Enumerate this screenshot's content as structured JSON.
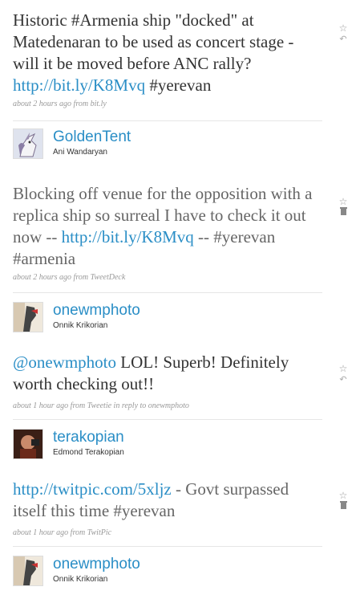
{
  "tweets": [
    {
      "segments": [
        "Historic #Armenia ship \"docked\" at Matedenaran to be used as concert stage - will it be moved before ANC rally? ",
        "http://bit.ly/K8Mvq",
        " #yerevan"
      ],
      "meta": "about 2 hours ago from bit.ly",
      "icons": [
        "star-icon",
        "reply-icon"
      ]
    },
    {
      "segments": [
        "Blocking off venue for the opposition with a replica ship so surreal I have to check it out now -- ",
        "http://bit.ly/K8Mvq",
        " -- #yerevan #armenia"
      ],
      "meta": "about 2 hours ago from TweetDeck",
      "icons": [
        "star-icon",
        "trash-icon"
      ]
    },
    {
      "segments": [
        "@",
        "onewmphoto",
        " LOL! Superb! Definitely worth checking out!!"
      ],
      "meta": "about 1 hour ago from Tweetie in reply to onewmphoto",
      "icons": [
        "star-icon",
        "reply-icon"
      ]
    },
    {
      "segments": [
        "http://twitpic.com/5xljz",
        " - Govt surpassed itself this time #yerevan"
      ],
      "meta": "about 1 hour ago from TwitPic",
      "icons": [
        "star-icon",
        "trash-icon"
      ]
    }
  ],
  "users": [
    {
      "screen_name": "GoldenTent",
      "full_name": "Ani Wandaryan",
      "avatar": "unicorn-avatar"
    },
    {
      "screen_name": "onewmphoto",
      "full_name": "Onnik Krikorian",
      "avatar": "sketch-avatar"
    },
    {
      "screen_name": "terakopian",
      "full_name": "Edmond Terakopian",
      "avatar": "photo-avatar"
    },
    {
      "screen_name": "onewmphoto",
      "full_name": "Onnik Krikorian",
      "avatar": "sketch-avatar"
    }
  ],
  "icon_glyphs": {
    "star": "☆",
    "reply": "↶",
    "trash": "🗑"
  },
  "colors": {
    "link": "#2a8ec6",
    "text_dark": "#333333",
    "text_grey": "#666666",
    "meta": "#999999"
  }
}
